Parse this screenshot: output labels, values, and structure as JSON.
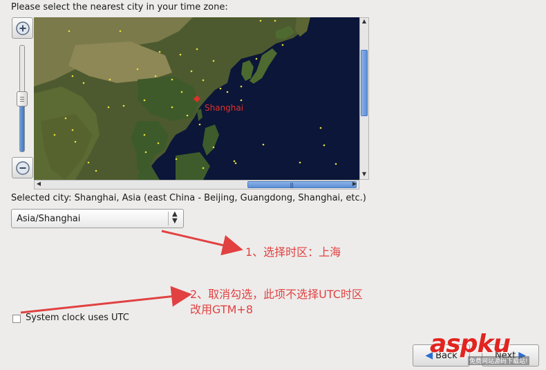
{
  "prompt": "Please select the nearest city in your time zone:",
  "map": {
    "city_label": "Shanghai",
    "zoom_in_icon": "zoom-in-icon",
    "zoom_out_icon": "zoom-out-icon"
  },
  "selected_city_text": "Selected city: Shanghai, Asia (east China - Beijing, Guangdong, Shanghai, etc.)",
  "timezone_combo": {
    "value": "Asia/Shanghai"
  },
  "annotations": {
    "step1": "1、选择时区：上海",
    "step2_line1": "2、取消勾选，此项不选择UTC时区",
    "step2_line2": "改用GTM+8"
  },
  "utc_checkbox": {
    "label": "System clock uses UTC",
    "checked": false
  },
  "buttons": {
    "back": "Back",
    "next": "Next"
  },
  "watermark": {
    "logo": "aspku",
    "tagline": "免费网站源码下载站!"
  },
  "colors": {
    "annotation_red": "#e14141",
    "map_ocean": "#0b1638",
    "city_marker": "#e0302a"
  }
}
